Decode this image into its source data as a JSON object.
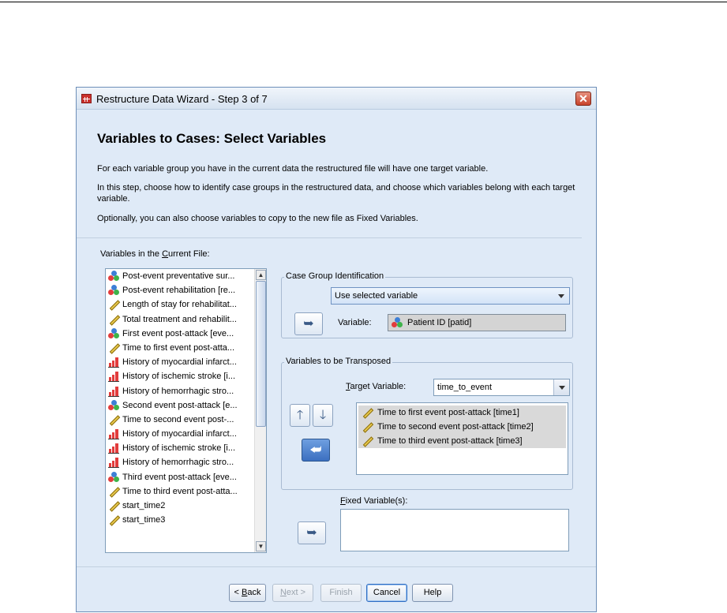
{
  "window": {
    "title": "Restructure Data Wizard - Step 3 of 7",
    "close_glyph": "✕"
  },
  "heading": "Variables to Cases: Select Variables",
  "intro": [
    "For each variable group you have in the current data the restructured file will have one target variable.",
    "In this step, choose how to identify case groups in the restructured data, and choose which variables belong with each target variable.",
    "Optionally, you can also choose variables to copy to the new file as Fixed Variables."
  ],
  "current_file": {
    "label_pre": "Variables in the ",
    "label_u": "C",
    "label_post": "urrent File:",
    "items": [
      {
        "label": "Post-event preventative sur...",
        "icon": "nominal-icon"
      },
      {
        "label": "Post-event rehabilitation [re...",
        "icon": "nominal-icon"
      },
      {
        "label": "Length of stay for rehabilitat...",
        "icon": "scale-icon"
      },
      {
        "label": "Total treatment and rehabilit...",
        "icon": "scale-icon"
      },
      {
        "label": "First event post-attack [eve...",
        "icon": "nominal-icon"
      },
      {
        "label": "Time to first event post-atta...",
        "icon": "scale-icon"
      },
      {
        "label": "History of myocardial infarct...",
        "icon": "ordinal-icon"
      },
      {
        "label": "History of ischemic stroke [i...",
        "icon": "ordinal-icon"
      },
      {
        "label": "History of hemorrhagic stro...",
        "icon": "ordinal-icon"
      },
      {
        "label": "Second event post-attack [e...",
        "icon": "nominal-icon"
      },
      {
        "label": "Time to second event post-...",
        "icon": "scale-icon"
      },
      {
        "label": "History of myocardial infarct...",
        "icon": "ordinal-icon"
      },
      {
        "label": "History of ischemic stroke [i...",
        "icon": "ordinal-icon"
      },
      {
        "label": "History of hemorrhagic stro...",
        "icon": "ordinal-icon"
      },
      {
        "label": "Third event post-attack [eve...",
        "icon": "nominal-icon"
      },
      {
        "label": "Time to third event post-atta...",
        "icon": "scale-icon"
      },
      {
        "label": "start_time2",
        "icon": "scale-icon"
      },
      {
        "label": "start_time3",
        "icon": "scale-icon"
      }
    ]
  },
  "case_group": {
    "legend": "Case Group Identification",
    "method_value": "Use selected variable",
    "variable_label": "Variable:",
    "variable_value": "Patient ID [patid]"
  },
  "transposed": {
    "legend": "Variables to be Transposed",
    "target_label_u": "T",
    "target_label_rest": "arget Variable:",
    "target_value": "time_to_event",
    "items": [
      "Time to first event post-attack [time1]",
      "Time to second event post-attack [time2]",
      "Time to third event post-attack [time3]"
    ]
  },
  "fixed": {
    "label_u": "F",
    "label_rest": "ixed Variable(s):"
  },
  "buttons": {
    "back_pre": "< ",
    "back_u": "B",
    "back_rest": "ack",
    "next_u": "N",
    "next_rest": "ext >",
    "finish": "Finish",
    "cancel": "Cancel",
    "help": "Help"
  }
}
